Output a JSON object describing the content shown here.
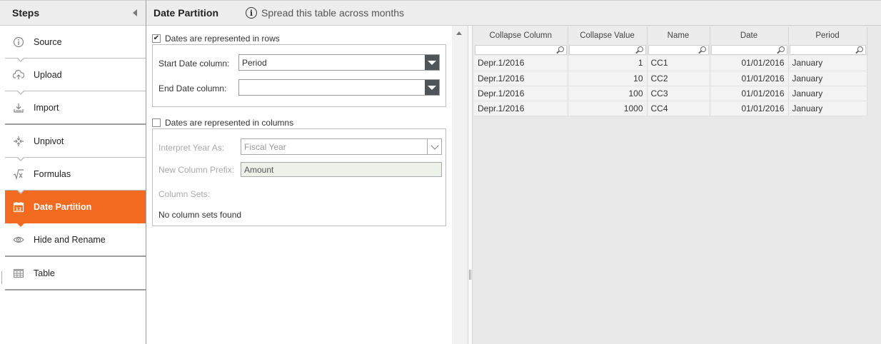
{
  "steps_panel": {
    "title": "Steps",
    "items": [
      {
        "label": "Source",
        "icon": "info-icon"
      },
      {
        "label": "Upload",
        "icon": "upload-icon"
      },
      {
        "label": "Import",
        "icon": "import-icon"
      },
      {
        "label": "Unpivot",
        "icon": "unpivot-icon"
      },
      {
        "label": "Formulas",
        "icon": "formula-icon"
      },
      {
        "label": "Date Partition",
        "icon": "calendar-icon",
        "active": true
      },
      {
        "label": "Hide and Rename",
        "icon": "eye-icon"
      },
      {
        "label": "Table",
        "icon": "table-icon"
      }
    ]
  },
  "header": {
    "title": "Date Partition",
    "subtitle": "Spread this table across months"
  },
  "rows_section": {
    "checkbox_label": "Dates are represented in rows",
    "checked": true,
    "start_label": "Start Date column:",
    "start_value": "Period",
    "end_label": "End Date column:",
    "end_value": ""
  },
  "columns_section": {
    "checkbox_label": "Dates are represented in columns",
    "checked": false,
    "interpret_label": "Interpret Year As:",
    "interpret_value": "Fiscal Year",
    "prefix_label": "New Column Prefix:",
    "prefix_value": "Amount",
    "sets_label": "Column Sets:",
    "sets_empty": "No column sets found"
  },
  "grid": {
    "columns": [
      "Collapse Column",
      "Collapse Value",
      "Name",
      "Date",
      "Period"
    ],
    "rows": [
      [
        "Depr.1/2016",
        "1",
        "CC1",
        "01/01/2016",
        "January"
      ],
      [
        "Depr.1/2016",
        "10",
        "CC2",
        "01/01/2016",
        "January"
      ],
      [
        "Depr.1/2016",
        "100",
        "CC3",
        "01/01/2016",
        "January"
      ],
      [
        "Depr.1/2016",
        "1000",
        "CC4",
        "01/01/2016",
        "January"
      ]
    ]
  },
  "colors": {
    "accent": "#f26b21",
    "header_bg": "#ededed",
    "dropdown_button": "#4f5458"
  }
}
